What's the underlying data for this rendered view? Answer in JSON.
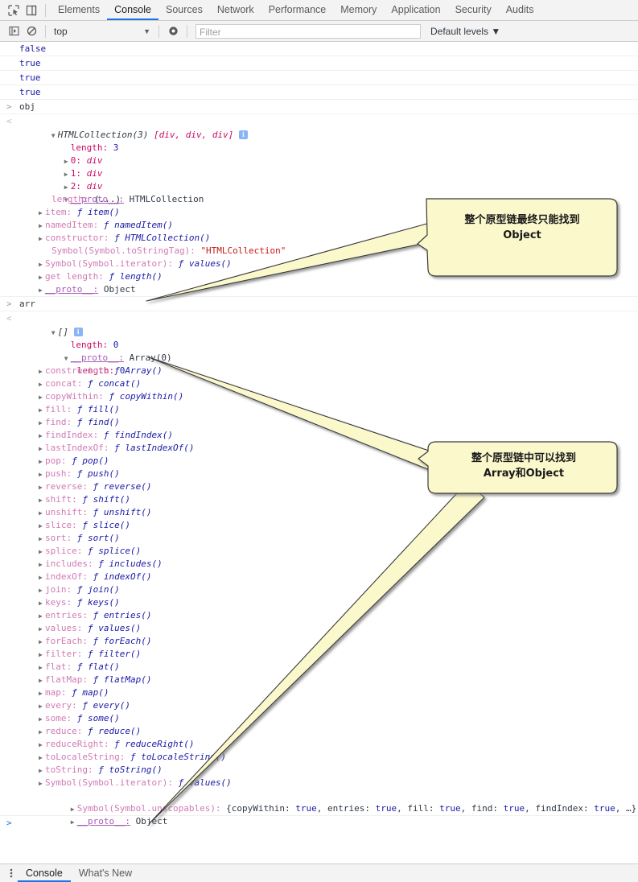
{
  "tabbar": {
    "icons": [
      {
        "name": "inspect-element-icon",
        "glyph": "inspect"
      },
      {
        "name": "device-toolbar-icon",
        "glyph": "device"
      }
    ],
    "tabs": [
      {
        "label": "Elements",
        "active": false
      },
      {
        "label": "Console",
        "active": true
      },
      {
        "label": "Sources",
        "active": false
      },
      {
        "label": "Network",
        "active": false
      },
      {
        "label": "Performance",
        "active": false
      },
      {
        "label": "Memory",
        "active": false
      },
      {
        "label": "Application",
        "active": false
      },
      {
        "label": "Security",
        "active": false
      },
      {
        "label": "Audits",
        "active": false
      }
    ]
  },
  "toolbar": {
    "sidebar_icon": "show-console-sidebar-icon",
    "clear_icon": "clear-console-icon",
    "context_value": "top",
    "context_caret": "▼",
    "eye_icon": "live-expression-icon",
    "filter_placeholder": "Filter",
    "filter_value": "",
    "levels_label": "Default levels",
    "levels_caret": "▼"
  },
  "console": {
    "results": [
      "false",
      "true",
      "true",
      "true"
    ],
    "command_obj": "obj",
    "command_arr": "arr",
    "gutter_in": ">",
    "gutter_out": "<",
    "prompt": ">",
    "info_badge": "i",
    "htmlcollection": {
      "header_type": "HTMLCollection(3)",
      "header_items": " [div, div, div] ",
      "length_key": "length:",
      "length_val": "3",
      "indexes": [
        {
          "key": "0:",
          "val": "div"
        },
        {
          "key": "1:",
          "val": "div"
        },
        {
          "key": "2:",
          "val": "div"
        }
      ],
      "proto_key": "__proto__:",
      "proto_val": "HTMLCollection",
      "proto_members": [
        {
          "tri": "",
          "key": "length:",
          "kind": "dim",
          "val": "(...)",
          "valkind": "plain"
        },
        {
          "tri": "▶",
          "key": "item:",
          "kind": "dim",
          "val": "ƒ item()",
          "valkind": "fn"
        },
        {
          "tri": "▶",
          "key": "namedItem:",
          "kind": "dim",
          "val": "ƒ namedItem()",
          "valkind": "fn"
        },
        {
          "tri": "▶",
          "key": "constructor:",
          "kind": "dim",
          "val": "ƒ HTMLCollection()",
          "valkind": "fn"
        },
        {
          "tri": "",
          "key": "Symbol(Symbol.toStringTag):",
          "kind": "dim",
          "val": "\"HTMLCollection\"",
          "valkind": "str"
        },
        {
          "tri": "▶",
          "key": "Symbol(Symbol.iterator):",
          "kind": "dim",
          "val": "ƒ values()",
          "valkind": "fn"
        },
        {
          "tri": "▶",
          "key": "get length:",
          "kind": "dim",
          "val": "ƒ length()",
          "valkind": "fn"
        },
        {
          "tri": "▶",
          "key": "__proto__:",
          "kind": "proto",
          "val": "Object",
          "valkind": "plain"
        }
      ]
    },
    "array": {
      "header": "[]",
      "length_key": "length:",
      "length_val": "0",
      "proto_key": "__proto__:",
      "proto_val": "Array(0)",
      "proto_length_key": "length:",
      "proto_length_val": "0",
      "members": [
        {
          "tri": "▶",
          "key": "constructor:",
          "kind": "dim",
          "val": "ƒ Array()",
          "valkind": "fn"
        },
        {
          "tri": "▶",
          "key": "concat:",
          "kind": "dim",
          "val": "ƒ concat()",
          "valkind": "fn"
        },
        {
          "tri": "▶",
          "key": "copyWithin:",
          "kind": "dim",
          "val": "ƒ copyWithin()",
          "valkind": "fn"
        },
        {
          "tri": "▶",
          "key": "fill:",
          "kind": "dim",
          "val": "ƒ fill()",
          "valkind": "fn"
        },
        {
          "tri": "▶",
          "key": "find:",
          "kind": "dim",
          "val": "ƒ find()",
          "valkind": "fn"
        },
        {
          "tri": "▶",
          "key": "findIndex:",
          "kind": "dim",
          "val": "ƒ findIndex()",
          "valkind": "fn"
        },
        {
          "tri": "▶",
          "key": "lastIndexOf:",
          "kind": "dim",
          "val": "ƒ lastIndexOf()",
          "valkind": "fn"
        },
        {
          "tri": "▶",
          "key": "pop:",
          "kind": "dim",
          "val": "ƒ pop()",
          "valkind": "fn"
        },
        {
          "tri": "▶",
          "key": "push:",
          "kind": "dim",
          "val": "ƒ push()",
          "valkind": "fn"
        },
        {
          "tri": "▶",
          "key": "reverse:",
          "kind": "dim",
          "val": "ƒ reverse()",
          "valkind": "fn"
        },
        {
          "tri": "▶",
          "key": "shift:",
          "kind": "dim",
          "val": "ƒ shift()",
          "valkind": "fn"
        },
        {
          "tri": "▶",
          "key": "unshift:",
          "kind": "dim",
          "val": "ƒ unshift()",
          "valkind": "fn"
        },
        {
          "tri": "▶",
          "key": "slice:",
          "kind": "dim",
          "val": "ƒ slice()",
          "valkind": "fn"
        },
        {
          "tri": "▶",
          "key": "sort:",
          "kind": "dim",
          "val": "ƒ sort()",
          "valkind": "fn"
        },
        {
          "tri": "▶",
          "key": "splice:",
          "kind": "dim",
          "val": "ƒ splice()",
          "valkind": "fn"
        },
        {
          "tri": "▶",
          "key": "includes:",
          "kind": "dim",
          "val": "ƒ includes()",
          "valkind": "fn"
        },
        {
          "tri": "▶",
          "key": "indexOf:",
          "kind": "dim",
          "val": "ƒ indexOf()",
          "valkind": "fn"
        },
        {
          "tri": "▶",
          "key": "join:",
          "kind": "dim",
          "val": "ƒ join()",
          "valkind": "fn"
        },
        {
          "tri": "▶",
          "key": "keys:",
          "kind": "dim",
          "val": "ƒ keys()",
          "valkind": "fn"
        },
        {
          "tri": "▶",
          "key": "entries:",
          "kind": "dim",
          "val": "ƒ entries()",
          "valkind": "fn"
        },
        {
          "tri": "▶",
          "key": "values:",
          "kind": "dim",
          "val": "ƒ values()",
          "valkind": "fn"
        },
        {
          "tri": "▶",
          "key": "forEach:",
          "kind": "dim",
          "val": "ƒ forEach()",
          "valkind": "fn"
        },
        {
          "tri": "▶",
          "key": "filter:",
          "kind": "dim",
          "val": "ƒ filter()",
          "valkind": "fn"
        },
        {
          "tri": "▶",
          "key": "flat:",
          "kind": "dim",
          "val": "ƒ flat()",
          "valkind": "fn"
        },
        {
          "tri": "▶",
          "key": "flatMap:",
          "kind": "dim",
          "val": "ƒ flatMap()",
          "valkind": "fn"
        },
        {
          "tri": "▶",
          "key": "map:",
          "kind": "dim",
          "val": "ƒ map()",
          "valkind": "fn"
        },
        {
          "tri": "▶",
          "key": "every:",
          "kind": "dim",
          "val": "ƒ every()",
          "valkind": "fn"
        },
        {
          "tri": "▶",
          "key": "some:",
          "kind": "dim",
          "val": "ƒ some()",
          "valkind": "fn"
        },
        {
          "tri": "▶",
          "key": "reduce:",
          "kind": "dim",
          "val": "ƒ reduce()",
          "valkind": "fn"
        },
        {
          "tri": "▶",
          "key": "reduceRight:",
          "kind": "dim",
          "val": "ƒ reduceRight()",
          "valkind": "fn"
        },
        {
          "tri": "▶",
          "key": "toLocaleString:",
          "kind": "dim",
          "val": "ƒ toLocaleString()",
          "valkind": "fn"
        },
        {
          "tri": "▶",
          "key": "toString:",
          "kind": "dim",
          "val": "ƒ toString()",
          "valkind": "fn"
        },
        {
          "tri": "▶",
          "key": "Symbol(Symbol.iterator):",
          "kind": "dim",
          "val": "ƒ values()",
          "valkind": "fn"
        }
      ],
      "unscopables": {
        "tri": "▶",
        "key": "Symbol(Symbol.unscopables):",
        "parts": [
          {
            "t": " {copyWithin: ",
            "k": "plain"
          },
          {
            "t": "true",
            "k": "bool"
          },
          {
            "t": ", entries: ",
            "k": "plain"
          },
          {
            "t": "true",
            "k": "bool"
          },
          {
            "t": ", fill: ",
            "k": "plain"
          },
          {
            "t": "true",
            "k": "bool"
          },
          {
            "t": ", find: ",
            "k": "plain"
          },
          {
            "t": "true",
            "k": "bool"
          },
          {
            "t": ", findIndex: ",
            "k": "plain"
          },
          {
            "t": "true",
            "k": "bool"
          },
          {
            "t": ", …}",
            "k": "plain"
          }
        ]
      },
      "final_proto": {
        "tri": "▶",
        "key": "__proto__:",
        "val": "Object"
      }
    }
  },
  "callouts": [
    {
      "name": "callout-object-only",
      "line1": "整个原型链最终只能找到",
      "line2": "Object",
      "fill": "#fbf8cc",
      "stroke": "#3a3a3a"
    },
    {
      "name": "callout-array-and-object",
      "line1": "整个原型链中可以找到",
      "line2": "Array和Object",
      "fill": "#fbf8cc",
      "stroke": "#3a3a3a"
    }
  ],
  "drawer": {
    "menu_icon": "more-options-icon",
    "tabs": [
      {
        "label": "Console",
        "active": true
      },
      {
        "label": "What's New",
        "active": false
      }
    ]
  }
}
